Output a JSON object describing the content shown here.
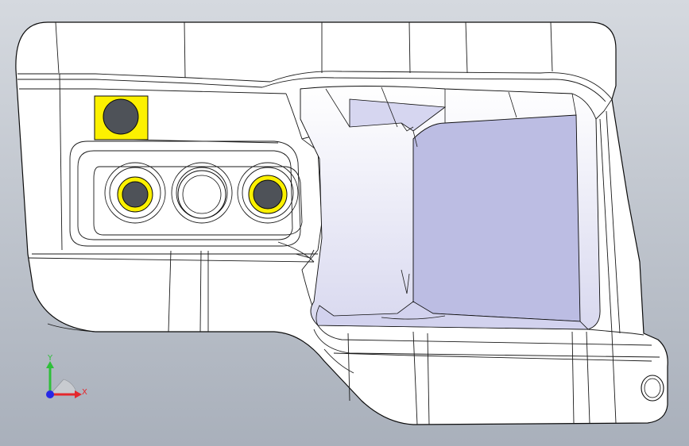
{
  "viewport": {
    "background_top": "#d5d9df",
    "background_bottom": "#a9b0bb",
    "model_fill": "#ffffff",
    "edge_color": "#0b0b0b",
    "pocket_fill": "#bcbde3",
    "pocket_fill_light": "#dcdcf2",
    "selected_face_color": "#fcf100",
    "hole_fill": "#4e5258"
  },
  "triad": {
    "x_label": "X",
    "y_label": "Y",
    "x_color": "#e4272d",
    "y_color": "#2fbf3a",
    "z_color": "#2727e6"
  }
}
